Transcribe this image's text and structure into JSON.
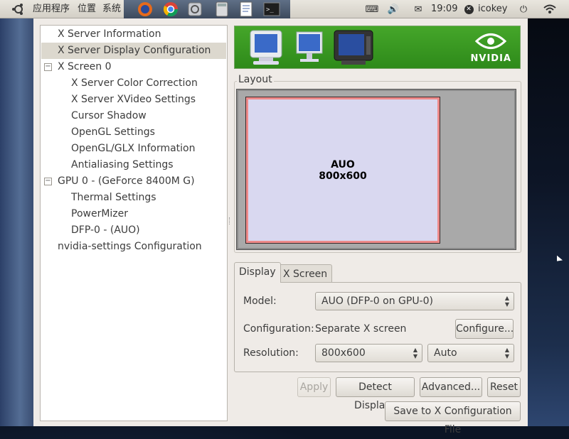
{
  "panel": {
    "menu_applications": "应用程序",
    "menu_places": "位置",
    "menu_system": "系统",
    "clock": "19:09",
    "user": "icokey"
  },
  "tree": {
    "items": [
      {
        "label": "X Server Information"
      },
      {
        "label": "X Server Display Configuration"
      },
      {
        "label": "X Screen 0"
      },
      {
        "label": "X Server Color Correction"
      },
      {
        "label": "X Server XVideo Settings"
      },
      {
        "label": "Cursor Shadow"
      },
      {
        "label": "OpenGL Settings"
      },
      {
        "label": "OpenGL/GLX Information"
      },
      {
        "label": "Antialiasing Settings"
      },
      {
        "label": "GPU 0 - (GeForce 8400M G)"
      },
      {
        "label": "Thermal Settings"
      },
      {
        "label": "PowerMizer"
      },
      {
        "label": "DFP-0 - (AUO)"
      },
      {
        "label": "nvidia-settings Configuration"
      }
    ]
  },
  "banner": {
    "logo_text": "NVIDIA"
  },
  "layout": {
    "label": "Layout",
    "screen_name": "AUO",
    "screen_resolution": "800x600"
  },
  "tabs": {
    "display": "Display",
    "x_screen": "X Screen"
  },
  "display_tab": {
    "model_label": "Model:",
    "model_value": "AUO (DFP-0 on GPU-0)",
    "configuration_label": "Configuration:",
    "configuration_value": "Separate X screen",
    "configure_button": "Configure...",
    "resolution_label": "Resolution:",
    "resolution_value": "800x600",
    "refresh_value": "Auto"
  },
  "buttons": {
    "apply": "Apply",
    "detect_displays": "Detect Displays",
    "advanced": "Advanced...",
    "reset": "Reset",
    "save": "Save to X Configuration File"
  },
  "colors": {
    "nvidia_green": "#3a9a22",
    "screen_fill": "#d9d8f0",
    "screen_border": "#ee8a8a",
    "selection": "#dcd8ce"
  }
}
